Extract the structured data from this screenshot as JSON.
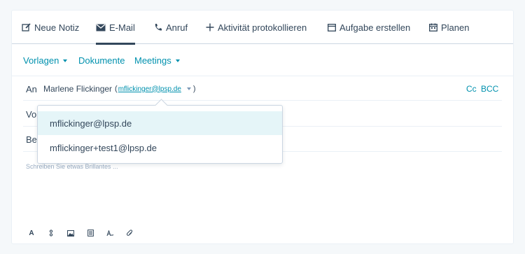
{
  "tabs": [
    {
      "label": "Neue Notiz",
      "icon": "edit-note-icon"
    },
    {
      "label": "E-Mail",
      "icon": "envelope-icon"
    },
    {
      "label": "Anruf",
      "icon": "phone-icon"
    },
    {
      "label": "Aktivität protokollieren",
      "icon": "plus-icon"
    },
    {
      "label": "Aufgabe erstellen",
      "icon": "task-icon"
    },
    {
      "label": "Planen",
      "icon": "calendar-icon"
    }
  ],
  "active_tab": "E-Mail",
  "subbar": {
    "templates": "Vorlagen",
    "documents": "Dokumente",
    "meetings": "Meetings"
  },
  "fields": {
    "to_label": "An",
    "from_label_partial": "Vor",
    "subject_label_partial": "Bet",
    "recipient_name": "Marlene Flickinger",
    "recipient_open_paren": "(",
    "recipient_email": "mflickinger@lpsp.de",
    "recipient_close_paren": ")",
    "cc": "Cc",
    "bcc": "BCC"
  },
  "editor": {
    "placeholder": "Schreiben Sie etwas Brillantes ..."
  },
  "dropdown": {
    "options": [
      "mflickinger@lpsp.de",
      "mflickinger+test1@lpsp.de"
    ],
    "highlighted_index": 0
  },
  "toolbar_icons": [
    "text-format-icon",
    "personalize-icon",
    "image-icon",
    "document-icon",
    "signature-icon",
    "attachment-icon"
  ],
  "colors": {
    "link": "#0091ae",
    "text": "#33475b",
    "highlight": "#e5f5f8"
  }
}
